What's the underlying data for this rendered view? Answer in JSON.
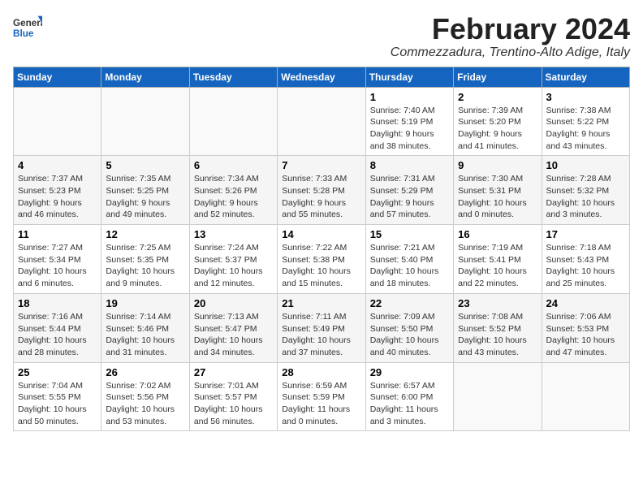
{
  "logo": {
    "general": "General",
    "blue": "Blue"
  },
  "header": {
    "title": "February 2024",
    "subtitle": "Commezzadura, Trentino-Alto Adige, Italy"
  },
  "days_of_week": [
    "Sunday",
    "Monday",
    "Tuesday",
    "Wednesday",
    "Thursday",
    "Friday",
    "Saturday"
  ],
  "weeks": [
    [
      {
        "day": "",
        "detail": ""
      },
      {
        "day": "",
        "detail": ""
      },
      {
        "day": "",
        "detail": ""
      },
      {
        "day": "",
        "detail": ""
      },
      {
        "day": "1",
        "detail": "Sunrise: 7:40 AM\nSunset: 5:19 PM\nDaylight: 9 hours\nand 38 minutes."
      },
      {
        "day": "2",
        "detail": "Sunrise: 7:39 AM\nSunset: 5:20 PM\nDaylight: 9 hours\nand 41 minutes."
      },
      {
        "day": "3",
        "detail": "Sunrise: 7:38 AM\nSunset: 5:22 PM\nDaylight: 9 hours\nand 43 minutes."
      }
    ],
    [
      {
        "day": "4",
        "detail": "Sunrise: 7:37 AM\nSunset: 5:23 PM\nDaylight: 9 hours\nand 46 minutes."
      },
      {
        "day": "5",
        "detail": "Sunrise: 7:35 AM\nSunset: 5:25 PM\nDaylight: 9 hours\nand 49 minutes."
      },
      {
        "day": "6",
        "detail": "Sunrise: 7:34 AM\nSunset: 5:26 PM\nDaylight: 9 hours\nand 52 minutes."
      },
      {
        "day": "7",
        "detail": "Sunrise: 7:33 AM\nSunset: 5:28 PM\nDaylight: 9 hours\nand 55 minutes."
      },
      {
        "day": "8",
        "detail": "Sunrise: 7:31 AM\nSunset: 5:29 PM\nDaylight: 9 hours\nand 57 minutes."
      },
      {
        "day": "9",
        "detail": "Sunrise: 7:30 AM\nSunset: 5:31 PM\nDaylight: 10 hours\nand 0 minutes."
      },
      {
        "day": "10",
        "detail": "Sunrise: 7:28 AM\nSunset: 5:32 PM\nDaylight: 10 hours\nand 3 minutes."
      }
    ],
    [
      {
        "day": "11",
        "detail": "Sunrise: 7:27 AM\nSunset: 5:34 PM\nDaylight: 10 hours\nand 6 minutes."
      },
      {
        "day": "12",
        "detail": "Sunrise: 7:25 AM\nSunset: 5:35 PM\nDaylight: 10 hours\nand 9 minutes."
      },
      {
        "day": "13",
        "detail": "Sunrise: 7:24 AM\nSunset: 5:37 PM\nDaylight: 10 hours\nand 12 minutes."
      },
      {
        "day": "14",
        "detail": "Sunrise: 7:22 AM\nSunset: 5:38 PM\nDaylight: 10 hours\nand 15 minutes."
      },
      {
        "day": "15",
        "detail": "Sunrise: 7:21 AM\nSunset: 5:40 PM\nDaylight: 10 hours\nand 18 minutes."
      },
      {
        "day": "16",
        "detail": "Sunrise: 7:19 AM\nSunset: 5:41 PM\nDaylight: 10 hours\nand 22 minutes."
      },
      {
        "day": "17",
        "detail": "Sunrise: 7:18 AM\nSunset: 5:43 PM\nDaylight: 10 hours\nand 25 minutes."
      }
    ],
    [
      {
        "day": "18",
        "detail": "Sunrise: 7:16 AM\nSunset: 5:44 PM\nDaylight: 10 hours\nand 28 minutes."
      },
      {
        "day": "19",
        "detail": "Sunrise: 7:14 AM\nSunset: 5:46 PM\nDaylight: 10 hours\nand 31 minutes."
      },
      {
        "day": "20",
        "detail": "Sunrise: 7:13 AM\nSunset: 5:47 PM\nDaylight: 10 hours\nand 34 minutes."
      },
      {
        "day": "21",
        "detail": "Sunrise: 7:11 AM\nSunset: 5:49 PM\nDaylight: 10 hours\nand 37 minutes."
      },
      {
        "day": "22",
        "detail": "Sunrise: 7:09 AM\nSunset: 5:50 PM\nDaylight: 10 hours\nand 40 minutes."
      },
      {
        "day": "23",
        "detail": "Sunrise: 7:08 AM\nSunset: 5:52 PM\nDaylight: 10 hours\nand 43 minutes."
      },
      {
        "day": "24",
        "detail": "Sunrise: 7:06 AM\nSunset: 5:53 PM\nDaylight: 10 hours\nand 47 minutes."
      }
    ],
    [
      {
        "day": "25",
        "detail": "Sunrise: 7:04 AM\nSunset: 5:55 PM\nDaylight: 10 hours\nand 50 minutes."
      },
      {
        "day": "26",
        "detail": "Sunrise: 7:02 AM\nSunset: 5:56 PM\nDaylight: 10 hours\nand 53 minutes."
      },
      {
        "day": "27",
        "detail": "Sunrise: 7:01 AM\nSunset: 5:57 PM\nDaylight: 10 hours\nand 56 minutes."
      },
      {
        "day": "28",
        "detail": "Sunrise: 6:59 AM\nSunset: 5:59 PM\nDaylight: 11 hours\nand 0 minutes."
      },
      {
        "day": "29",
        "detail": "Sunrise: 6:57 AM\nSunset: 6:00 PM\nDaylight: 11 hours\nand 3 minutes."
      },
      {
        "day": "",
        "detail": ""
      },
      {
        "day": "",
        "detail": ""
      }
    ]
  ]
}
